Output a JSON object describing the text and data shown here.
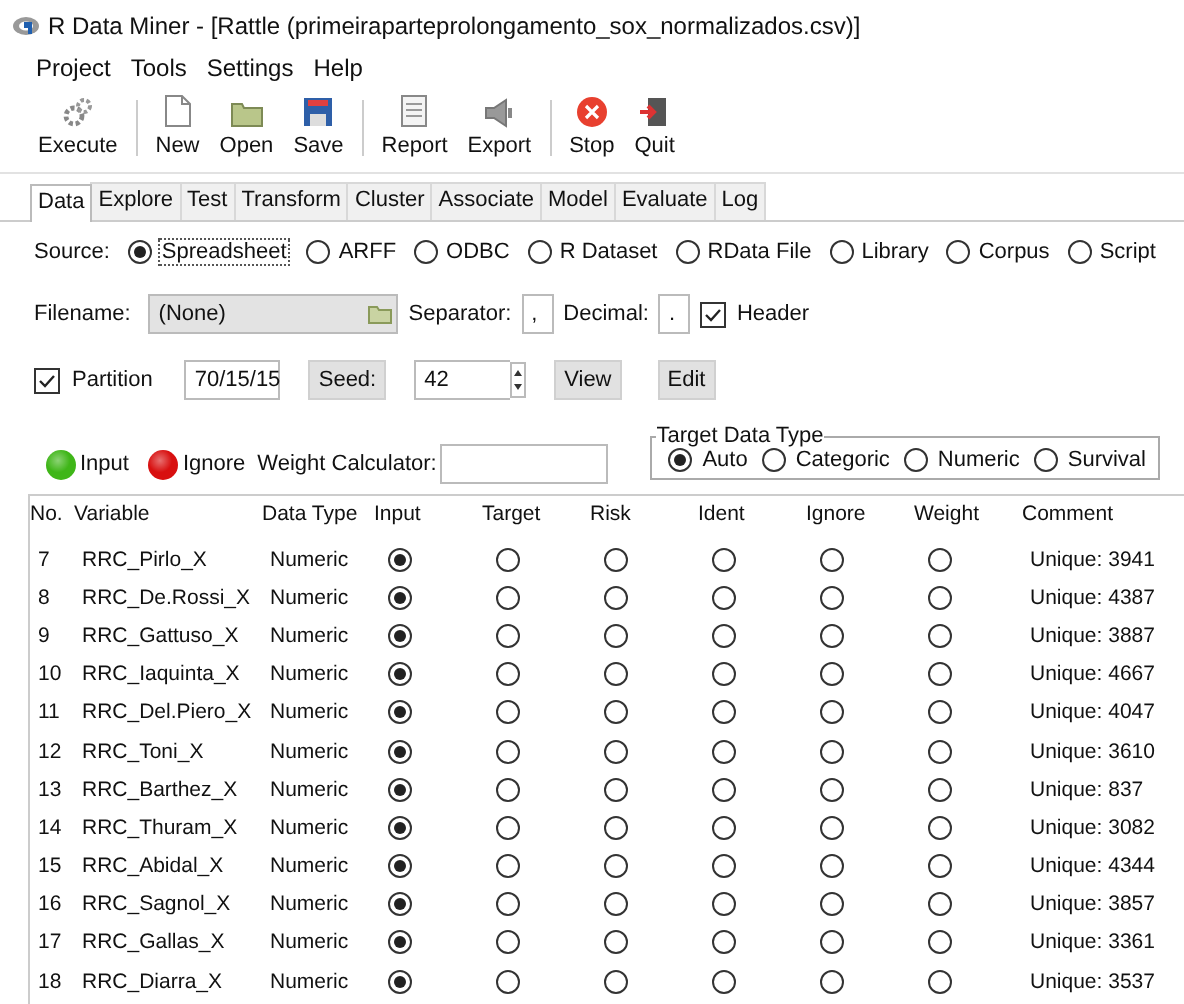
{
  "window": {
    "title": "R Data Miner - [Rattle (primeiraparteprolongamento_sox_normalizados.csv)]"
  },
  "menu": [
    "Project",
    "Tools",
    "Settings",
    "Help"
  ],
  "toolbar_groups": [
    [
      {
        "label": "Execute",
        "kind": "execute"
      }
    ],
    [
      {
        "label": "New",
        "kind": "new"
      },
      {
        "label": "Open",
        "kind": "open"
      },
      {
        "label": "Save",
        "kind": "save"
      }
    ],
    [
      {
        "label": "Report",
        "kind": "report"
      },
      {
        "label": "Export",
        "kind": "export"
      }
    ],
    [
      {
        "label": "Stop",
        "kind": "stop"
      },
      {
        "label": "Quit",
        "kind": "quit"
      }
    ]
  ],
  "tabs": [
    {
      "label": "Data",
      "selected": true
    },
    {
      "label": "Explore",
      "selected": false
    },
    {
      "label": "Test",
      "selected": false
    },
    {
      "label": "Transform",
      "selected": false
    },
    {
      "label": "Cluster",
      "selected": false
    },
    {
      "label": "Associate",
      "selected": false
    },
    {
      "label": "Model",
      "selected": false
    },
    {
      "label": "Evaluate",
      "selected": false
    },
    {
      "label": "Log",
      "selected": false
    }
  ],
  "source": {
    "label": "Source:",
    "options": [
      {
        "label": "Spreadsheet",
        "selected": true
      },
      {
        "label": "ARFF",
        "selected": false
      },
      {
        "label": "ODBC",
        "selected": false
      },
      {
        "label": "R Dataset",
        "selected": false
      },
      {
        "label": "RData File",
        "selected": false
      },
      {
        "label": "Library",
        "selected": false
      },
      {
        "label": "Corpus",
        "selected": false
      },
      {
        "label": "Script",
        "selected": false
      }
    ]
  },
  "file_row": {
    "filename_label": "Filename:",
    "filename": "(None)",
    "separator_label": "Separator:",
    "separator": ",",
    "decimal_label": "Decimal:",
    "decimal": ".",
    "header_label": "Header",
    "header_checked": true
  },
  "partition_row": {
    "partition_label": "Partition",
    "partition_checked": true,
    "partition": "70/15/15",
    "seed_button": "Seed:",
    "seed": "42",
    "view_button": "View",
    "edit_button": "Edit"
  },
  "legend": [
    {
      "label": "Input",
      "color": "#3fb618"
    },
    {
      "label": "Ignore",
      "color": "#d81010"
    }
  ],
  "weight_label": "Weight Calculator:",
  "target_type": {
    "title": "Target Data Type",
    "options": [
      {
        "label": "Auto",
        "selected": true
      },
      {
        "label": "Categoric",
        "selected": false
      },
      {
        "label": "Numeric",
        "selected": false
      },
      {
        "label": "Survival",
        "selected": false
      }
    ]
  },
  "table": {
    "columns": [
      "No.",
      "Variable",
      "Data Type",
      "Input",
      "Target",
      "Risk",
      "Ident",
      "Ignore",
      "Weight",
      "Comment"
    ],
    "rows": [
      {
        "no": "7",
        "variable": "RRC_Pirlo_X",
        "data_type": "Numeric",
        "input": true,
        "target": false,
        "risk": false,
        "ident": false,
        "ignore": false,
        "weight": false,
        "comment": "Unique: 3941"
      },
      {
        "no": "8",
        "variable": "RRC_De.Rossi_X",
        "data_type": "Numeric",
        "input": true,
        "target": false,
        "risk": false,
        "ident": false,
        "ignore": false,
        "weight": false,
        "comment": "Unique: 4387"
      },
      {
        "no": "9",
        "variable": "RRC_Gattuso_X",
        "data_type": "Numeric",
        "input": true,
        "target": false,
        "risk": false,
        "ident": false,
        "ignore": false,
        "weight": false,
        "comment": "Unique: 3887"
      },
      {
        "no": "10",
        "variable": "RRC_Iaquinta_X",
        "data_type": "Numeric",
        "input": true,
        "target": false,
        "risk": false,
        "ident": false,
        "ignore": false,
        "weight": false,
        "comment": "Unique: 4667"
      },
      {
        "no": "11",
        "variable": "RRC_Del.Piero_X",
        "data_type": "Numeric",
        "input": true,
        "target": false,
        "risk": false,
        "ident": false,
        "ignore": false,
        "weight": false,
        "comment": "Unique: 4047"
      },
      {
        "no": "12",
        "variable": "RRC_Toni_X",
        "data_type": "Numeric",
        "input": true,
        "target": false,
        "risk": false,
        "ident": false,
        "ignore": false,
        "weight": false,
        "comment": "Unique: 3610"
      },
      {
        "no": "13",
        "variable": "RRC_Barthez_X",
        "data_type": "Numeric",
        "input": true,
        "target": false,
        "risk": false,
        "ident": false,
        "ignore": false,
        "weight": false,
        "comment": "Unique: 837"
      },
      {
        "no": "14",
        "variable": "RRC_Thuram_X",
        "data_type": "Numeric",
        "input": true,
        "target": false,
        "risk": false,
        "ident": false,
        "ignore": false,
        "weight": false,
        "comment": "Unique: 3082"
      },
      {
        "no": "15",
        "variable": "RRC_Abidal_X",
        "data_type": "Numeric",
        "input": true,
        "target": false,
        "risk": false,
        "ident": false,
        "ignore": false,
        "weight": false,
        "comment": "Unique: 4344"
      },
      {
        "no": "16",
        "variable": "RRC_Sagnol_X",
        "data_type": "Numeric",
        "input": true,
        "target": false,
        "risk": false,
        "ident": false,
        "ignore": false,
        "weight": false,
        "comment": "Unique: 3857"
      },
      {
        "no": "17",
        "variable": "RRC_Gallas_X",
        "data_type": "Numeric",
        "input": true,
        "target": false,
        "risk": false,
        "ident": false,
        "ignore": false,
        "weight": false,
        "comment": "Unique: 3361"
      },
      {
        "no": "18",
        "variable": "RRC_Diarra_X",
        "data_type": "Numeric",
        "input": true,
        "target": false,
        "risk": false,
        "ident": false,
        "ignore": false,
        "weight": false,
        "comment": "Unique: 3537"
      }
    ]
  }
}
